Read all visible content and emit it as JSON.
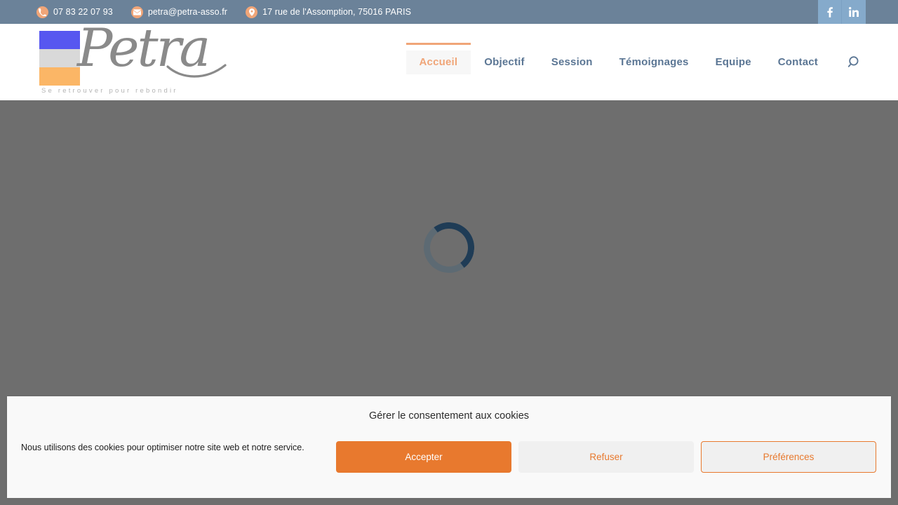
{
  "topbar": {
    "phone": {
      "icon": "phone-icon",
      "text": "07 83 22 07 93"
    },
    "email": {
      "icon": "email-icon",
      "text": "petra@petra-asso.fr"
    },
    "address": {
      "icon": "location-pin-icon",
      "text": "17 rue de l'Assomption, 75016 PARIS"
    },
    "social": [
      {
        "icon": "facebook-icon",
        "label": "f"
      },
      {
        "icon": "linkedin-icon",
        "label": "in"
      }
    ],
    "background_color": "#6b8299",
    "icon_color": "#f0a578",
    "social_background_color": "#85aacb"
  },
  "header": {
    "logo": {
      "wordmark": "Petra",
      "tagline": "Se retrouver pour rebondir",
      "bar_colors": [
        "#5757f0",
        "#d9d9d9",
        "#fbb666"
      ]
    },
    "nav": [
      {
        "label": "Accueil",
        "active": true
      },
      {
        "label": "Objectif",
        "active": false
      },
      {
        "label": "Session",
        "active": false
      },
      {
        "label": "Témoignages",
        "active": false
      },
      {
        "label": "Equipe",
        "active": false
      },
      {
        "label": "Contact",
        "active": false
      }
    ],
    "search_icon": "search-icon",
    "nav_color": "#5b7694",
    "accent_color": "#f0a578"
  },
  "main": {
    "state": "loading",
    "spinner": {
      "track_color": "#5d6a73",
      "arc_color": "#1f3c56"
    },
    "overlay_color": "#6e6e6e"
  },
  "cookie_banner": {
    "title": "Gérer le consentement aux cookies",
    "description": "Nous utilisons des cookies pour optimiser notre site web et notre service.",
    "buttons": [
      {
        "label": "Accepter",
        "style": "primary"
      },
      {
        "label": "Refuser",
        "style": "secondary"
      },
      {
        "label": "Préférences",
        "style": "outline"
      }
    ],
    "primary_color": "#e8792e",
    "background_color": "#f9f9f9"
  }
}
